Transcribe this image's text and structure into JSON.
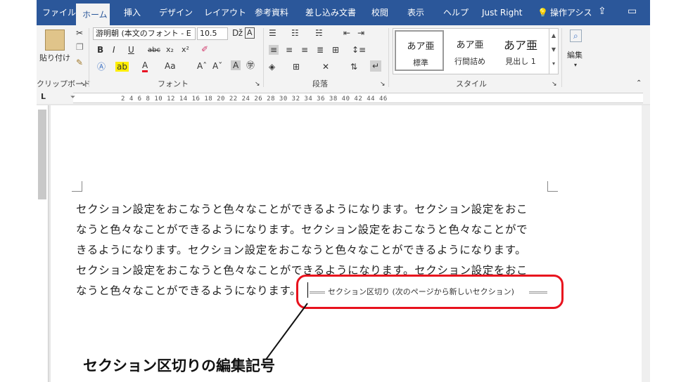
{
  "ribbon_tabs": {
    "file": "ファイル",
    "home": "ホーム",
    "insert": "挿入",
    "design": "デザイン",
    "layout": "レイアウト",
    "references": "参考資料",
    "mailings": "差し込み文書",
    "review": "校閲",
    "view": "表示",
    "help": "ヘルプ",
    "justright": "Just Right",
    "tellme": "操作アシス"
  },
  "clipboard": {
    "paste": "貼り付け",
    "label": "クリップボード"
  },
  "font": {
    "name": "游明朝 (本文のフォント - E",
    "size": "10.5",
    "label": "フォント",
    "case": "Aa"
  },
  "paragraph": {
    "label": "段落"
  },
  "styles": {
    "label": "スタイル",
    "items": [
      {
        "preview": "あア亜",
        "name": "標準"
      },
      {
        "preview": "あア亜",
        "name": "行間詰め"
      },
      {
        "preview": "あア亜",
        "name": "見出し 1"
      }
    ]
  },
  "editing": {
    "label": "編集"
  },
  "ruler": {
    "numbers": "2  4  6  8  10 12 14 16 18 20 22 24 26 28 30 32 34 36 38 40 42 44 46"
  },
  "document": {
    "lines": [
      "セクション設定をおこなうと色々なことができるようになります。セクション設定をおこ",
      "なうと色々なことができるようになります。セクション設定をおこなうと色々なことがで",
      "きるようになります。セクション設定をおこなうと色々なことができるようになります。",
      "セクション設定をおこなうと色々なことができるようになります。セクション設定をおこ",
      "なうと色々なことができるようになります。"
    ],
    "section_break": "セクション区切り (次のページから新しいセクション)"
  },
  "annotation": {
    "caption": "セクション区切りの編集記号",
    "highlight_color": "#e8121d"
  },
  "colors": {
    "tab_bar": "#2b579a",
    "ribbon_bg": "#f3f3f3"
  }
}
